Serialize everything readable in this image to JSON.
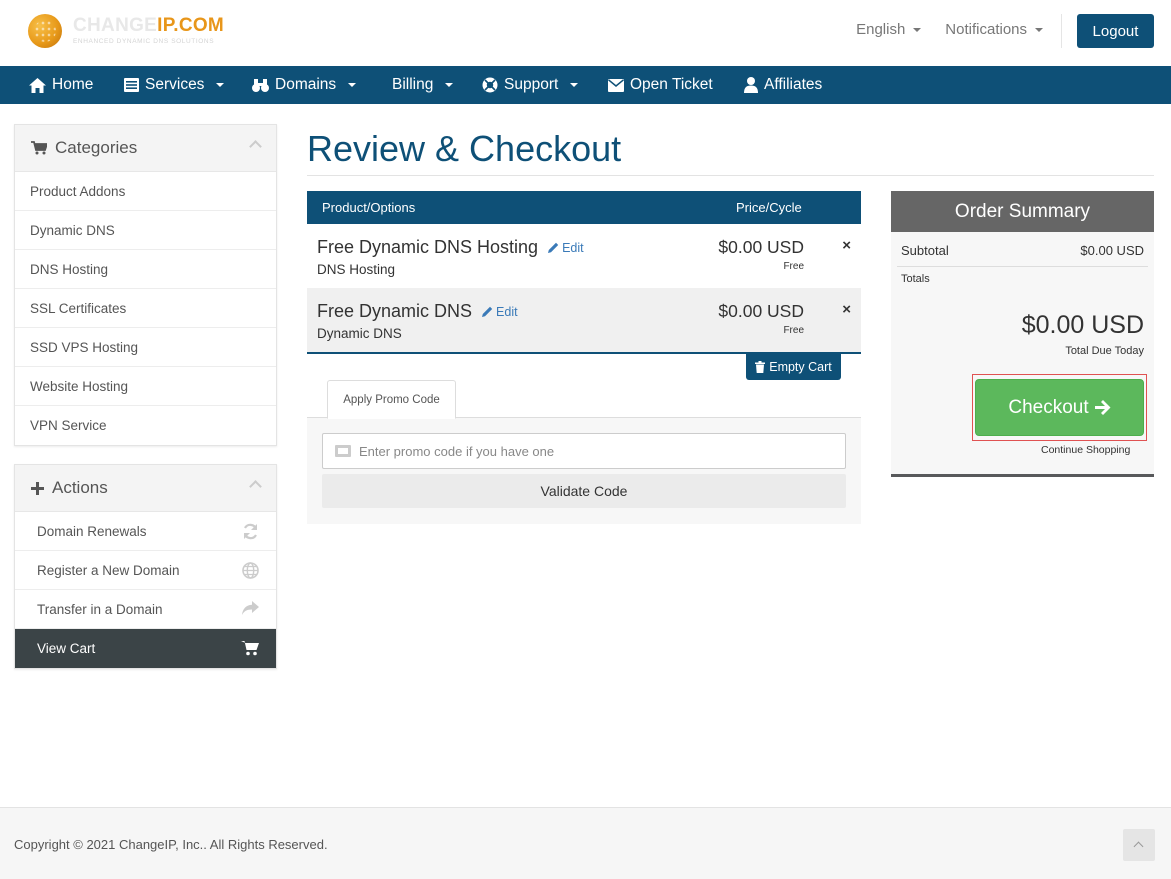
{
  "header": {
    "logo_primary": "CHANGE",
    "logo_secondary": "IP.COM",
    "logo_tagline": "ENHANCED DYNAMIC DNS SOLUTIONS",
    "language_label": "English",
    "notifications_label": "Notifications",
    "logout_label": "Logout"
  },
  "nav": {
    "items": [
      {
        "label": "Home",
        "icon": "home-icon"
      },
      {
        "label": "Services",
        "icon": "list-icon",
        "dropdown": true
      },
      {
        "label": "Domains",
        "icon": "binoculars-icon",
        "dropdown": true
      },
      {
        "label": "Billing",
        "dropdown": true
      },
      {
        "label": "Support",
        "icon": "life-ring-icon",
        "dropdown": true
      },
      {
        "label": "Open Ticket",
        "icon": "envelope-icon"
      },
      {
        "label": "Affiliates",
        "icon": "user-icon"
      }
    ]
  },
  "sidebar": {
    "categories": {
      "title": "Categories",
      "items": [
        "Product Addons",
        "Dynamic DNS",
        "DNS Hosting",
        "SSL Certificates",
        "SSD VPS Hosting",
        "Website Hosting",
        "VPN Service"
      ]
    },
    "actions": {
      "title": "Actions",
      "items": [
        {
          "label": "Domain Renewals",
          "icon": "refresh-icon"
        },
        {
          "label": "Register a New Domain",
          "icon": "globe-icon"
        },
        {
          "label": "Transfer in a Domain",
          "icon": "share-icon"
        },
        {
          "label": "View Cart",
          "icon": "cart-icon",
          "active": true
        }
      ]
    }
  },
  "main": {
    "title": "Review & Checkout",
    "cart": {
      "col_product": "Product/Options",
      "col_price": "Price/Cycle",
      "items": [
        {
          "name": "Free Dynamic DNS Hosting",
          "group": "DNS Hosting",
          "price": "$0.00 USD",
          "cycle": "Free",
          "edit": "Edit"
        },
        {
          "name": "Free Dynamic DNS",
          "group": "Dynamic DNS",
          "price": "$0.00 USD",
          "cycle": "Free",
          "edit": "Edit"
        }
      ],
      "remove_symbol": "×",
      "empty_cart_label": "Empty Cart"
    },
    "promo": {
      "tab_label": "Apply Promo Code",
      "placeholder": "Enter promo code if you have one",
      "validate_label": "Validate Code"
    }
  },
  "summary": {
    "title": "Order Summary",
    "subtotal_label": "Subtotal",
    "subtotal_value": "$0.00 USD",
    "totals_label": "Totals",
    "total_value": "$0.00 USD",
    "total_due_label": "Total Due Today",
    "checkout_label": "Checkout",
    "continue_label": "Continue Shopping"
  },
  "footer": {
    "copyright": "Copyright © 2021 ChangeIP, Inc.. All Rights Reserved."
  },
  "colors": {
    "brand": "#0e5077",
    "accent": "#e8961a",
    "success": "#5cb85c"
  }
}
